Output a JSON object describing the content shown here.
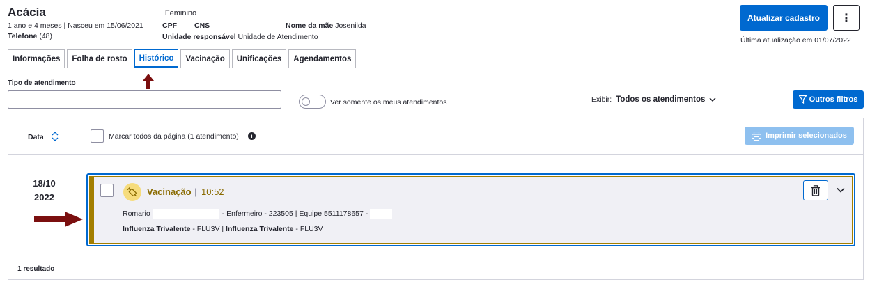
{
  "patient": {
    "name": "Acácia",
    "age_birth": "1 ano e 4 meses | Nasceu em 15/06/2021",
    "phone_label": "Telefone",
    "phone_value": "(48)",
    "sex": "| Feminino",
    "cpf_label": "CPF",
    "cpf_value": "—",
    "cns_label": "CNS",
    "cns_value": "",
    "mother_label": "Nome da mãe",
    "mother_value": "Josenilda",
    "unit_label": "Unidade responsável",
    "unit_value": "Unidade de Atendimento"
  },
  "actions": {
    "update_label": "Atualizar cadastro",
    "more_label": "⋮",
    "last_update": "Última atualização em 01/07/2022"
  },
  "tabs": [
    {
      "label": "Informações"
    },
    {
      "label": "Folha de rosto"
    },
    {
      "label": "Histórico"
    },
    {
      "label": "Vacinação"
    },
    {
      "label": "Unificações"
    },
    {
      "label": "Agendamentos"
    }
  ],
  "active_tab": "Histórico",
  "filters": {
    "tipo_label": "Tipo de atendimento",
    "tipo_value": "",
    "toggle_label": "Ver somente os meus atendimentos",
    "toggle_on": false,
    "exibir_label": "Exibir:",
    "exibir_value": "Todos os atendimentos",
    "more_filters_label": "Outros filtros"
  },
  "list_header": {
    "date_label": "Data",
    "select_all_label": "Marcar todos da página (1 atendimento)",
    "print_label": "Imprimir selecionados"
  },
  "records": [
    {
      "date_day": "18/10",
      "date_year": "2022",
      "type": "Vacinação",
      "time": "10:52",
      "professional": "Romario",
      "role": "- Enfermeiro - 223505 | Equipe 5511178657 -",
      "immuno_1_name": "Influenza Trivalente",
      "immuno_1_code": " - FLU3V | ",
      "immuno_2_name": "Influenza Trivalente",
      "immuno_2_code": " - FLU3V"
    }
  ],
  "footer": {
    "result_count": "1 resultado"
  },
  "colors": {
    "primary": "#0069d0",
    "vaccine_accent": "#a37e00",
    "vaccine_icon_bg": "#f6dc7d",
    "annotation_arrow": "#7b0f0f"
  }
}
